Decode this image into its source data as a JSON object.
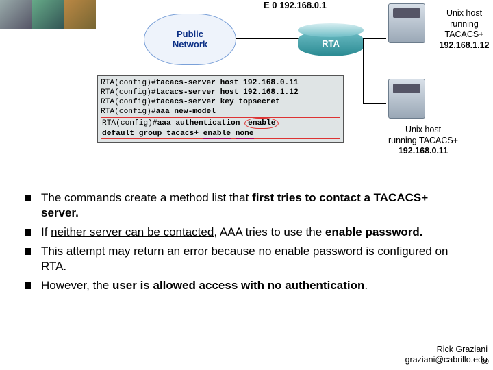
{
  "diagram": {
    "cloud_label": "Public\nNetwork",
    "router_label": "RTA",
    "router_iface": "E 0 192.168.0.1",
    "server1": {
      "line1": "Unix host",
      "line2": "running",
      "line3": "TACACS+",
      "ip": "192.168.1.12"
    },
    "server2": {
      "line1": "Unix host",
      "line2": "running TACACS+",
      "ip": "192.168.0.11"
    }
  },
  "terminal": {
    "rows": [
      {
        "prompt": "RTA(config)#",
        "cmd": "tacacs-server host 192.168.0.11"
      },
      {
        "prompt": "RTA(config)#",
        "cmd": "tacacs-server host 192.168.1.12"
      },
      {
        "prompt": "RTA(config)#",
        "cmd": "tacacs-server key topsecret"
      },
      {
        "prompt": "RTA(config)#",
        "cmd": "aaa new-model"
      }
    ],
    "hl": {
      "prompt": "RTA(config)#",
      "pre": "aaa authentication ",
      "oval": "enable",
      "cont": "default group tacacs+ ",
      "u1": "enable",
      "sp": " ",
      "u2": "none"
    }
  },
  "bullets": {
    "items": [
      {
        "pre": "The commands create a method list that ",
        "b1": "first tries to contact a TACACS+ server.",
        "post": ""
      },
      {
        "pre": "If ",
        "u1": "neither server can be contacted",
        "mid": ", AAA tries to use the ",
        "b1": "enable password.",
        "post": ""
      },
      {
        "pre": "This attempt may return an error because ",
        "u1": "no enable password",
        "mid": " is configured on RTA.",
        "b1": "",
        "post": ""
      },
      {
        "pre": "However, the ",
        "b1": "user is allowed access with no authentication",
        "post": "."
      }
    ]
  },
  "footer": {
    "name": "Rick Graziani",
    "email": "graziani@cabrillo.edu",
    "page": "30"
  }
}
